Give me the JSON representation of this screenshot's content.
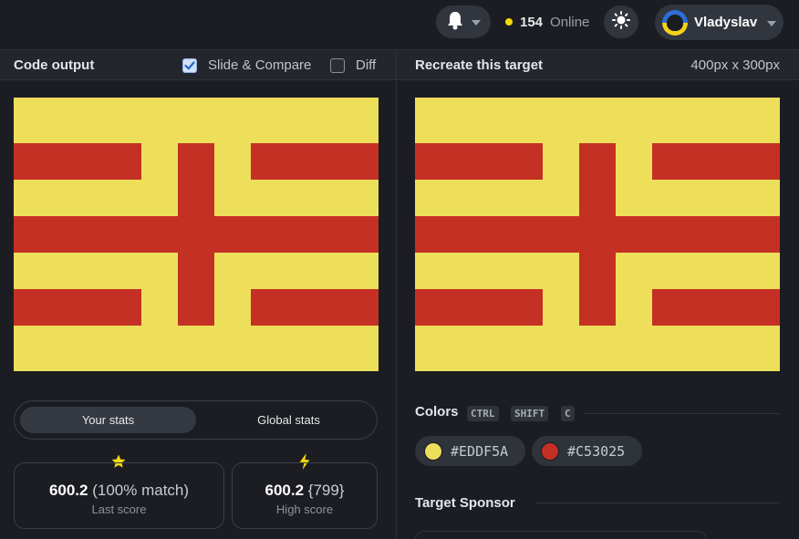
{
  "topbar": {
    "online_count": "154",
    "online_label": "Online",
    "user_name": "Vladyslav"
  },
  "left_panel": {
    "title": "Code output",
    "slide_compare_label": "Slide & Compare",
    "slide_compare_checked": true,
    "diff_label": "Diff",
    "diff_checked": false
  },
  "right_panel": {
    "title": "Recreate this target",
    "dimensions": "400px x 300px"
  },
  "stats": {
    "tab_your": "Your stats",
    "tab_global": "Global stats",
    "last_score_value": "600.2",
    "last_score_match": "(100% match)",
    "last_score_label": "Last score",
    "high_score_value": "600.2",
    "high_score_extra": "{799}",
    "high_score_label": "High score"
  },
  "colors": {
    "title": "Colors",
    "shortcut": [
      "CTRL",
      "SHIFT",
      "C"
    ],
    "swatches": [
      {
        "hex": "#EDDF5A",
        "color": "#EDDF5A"
      },
      {
        "hex": "#C53025",
        "color": "#C53025"
      }
    ]
  },
  "sponsor": {
    "title": "Target Sponsor"
  },
  "theme": {
    "flag_background": "#EDDF5A",
    "flag_bars": "#C53025",
    "accent_dot": "#F5D90A"
  }
}
